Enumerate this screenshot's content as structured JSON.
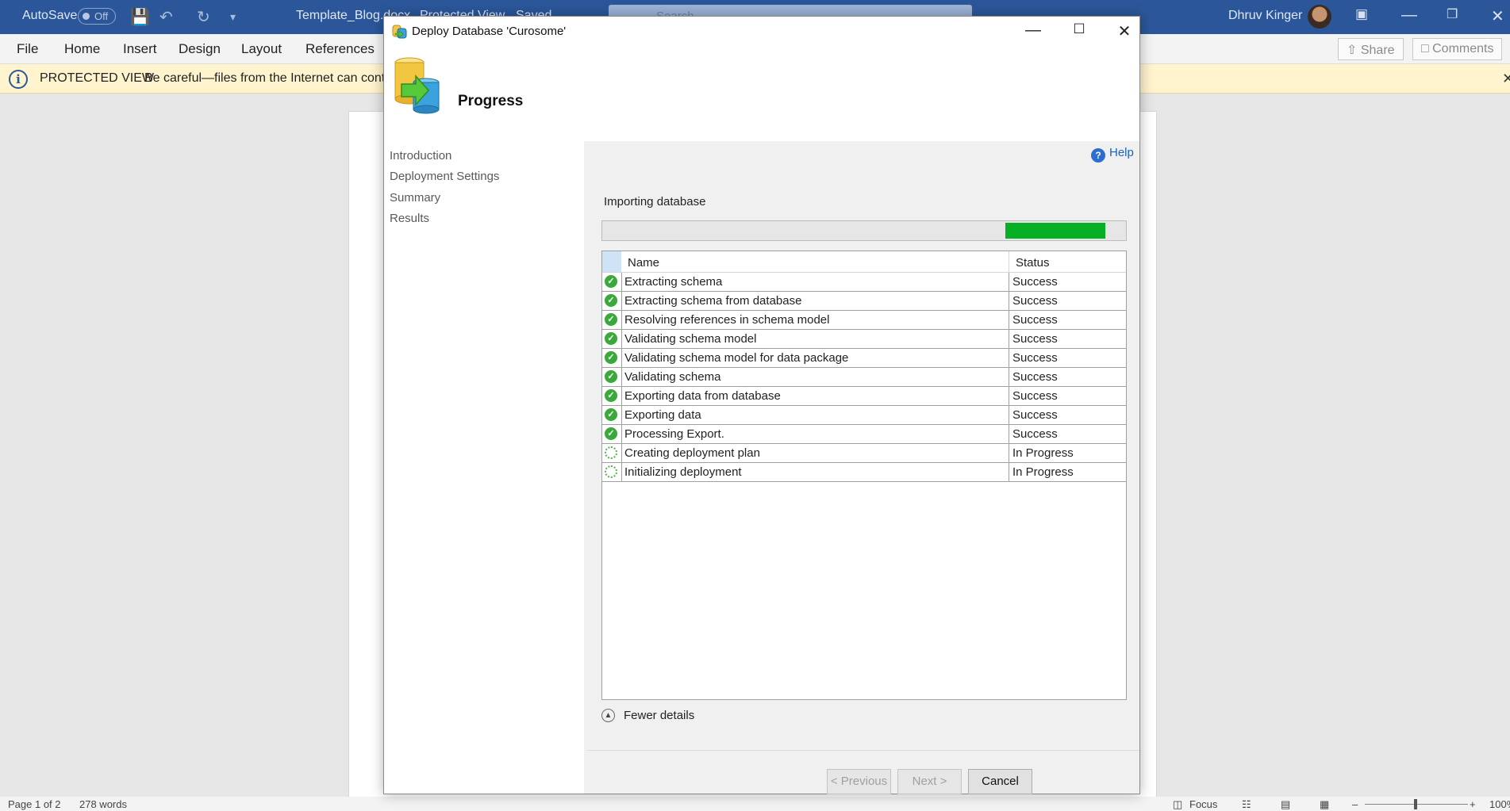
{
  "word": {
    "autosave_label": "AutoSave",
    "autosave_state": "Off",
    "doc_title": "Template_Blog.docx",
    "protected_status": "Protected View",
    "save_status": "Saved",
    "search_placeholder": "Search",
    "user_name": "Dhruv Kinger",
    "tabs": [
      "File",
      "Home",
      "Insert",
      "Design",
      "Layout",
      "References"
    ],
    "share_label": "Share",
    "comments_label": "Comments",
    "protected_view": {
      "label": "PROTECTED VIEW",
      "message": "Be careful—files from the Internet can contain"
    },
    "statusbar": {
      "page": "Page 1 of 2",
      "words": "278 words",
      "focus": "Focus",
      "zoom": "100%"
    }
  },
  "dialog": {
    "title": "Deploy Database 'Curosome'",
    "header_title": "Progress",
    "nav": [
      "Introduction",
      "Deployment Settings",
      "Summary",
      "Results"
    ],
    "help_label": "Help",
    "stage_label": "Importing database",
    "progress": {
      "fill_start": 0.77,
      "fill_end": 0.96
    },
    "columns": {
      "name": "Name",
      "status": "Status"
    },
    "steps": [
      {
        "name": "Extracting schema",
        "status": "Success",
        "icon": "success-check"
      },
      {
        "name": "Extracting schema from database",
        "status": "Success",
        "icon": "success-check"
      },
      {
        "name": "Resolving references in schema model",
        "status": "Success",
        "icon": "success-check"
      },
      {
        "name": "Validating schema model",
        "status": "Success",
        "icon": "success-check"
      },
      {
        "name": "Validating schema model for data package",
        "status": "Success",
        "icon": "success-check"
      },
      {
        "name": "Validating schema",
        "status": "Success",
        "icon": "success-check"
      },
      {
        "name": "Exporting data from database",
        "status": "Success",
        "icon": "success-check"
      },
      {
        "name": "Exporting data",
        "status": "Success",
        "icon": "success-check"
      },
      {
        "name": "Processing Export.",
        "status": "Success",
        "icon": "success-check"
      },
      {
        "name": "Creating deployment plan",
        "status": "In Progress",
        "icon": "spinner"
      },
      {
        "name": "Initializing deployment",
        "status": "In Progress",
        "icon": "spinner"
      }
    ],
    "details_toggle": "Fewer details",
    "buttons": {
      "previous": "< Previous",
      "next": "Next >",
      "cancel": "Cancel"
    }
  },
  "colors": {
    "word_blue": "#2b579a",
    "progress_green": "#06b025",
    "protected_bar": "#fff4ce",
    "help_link": "#1a62c0"
  }
}
